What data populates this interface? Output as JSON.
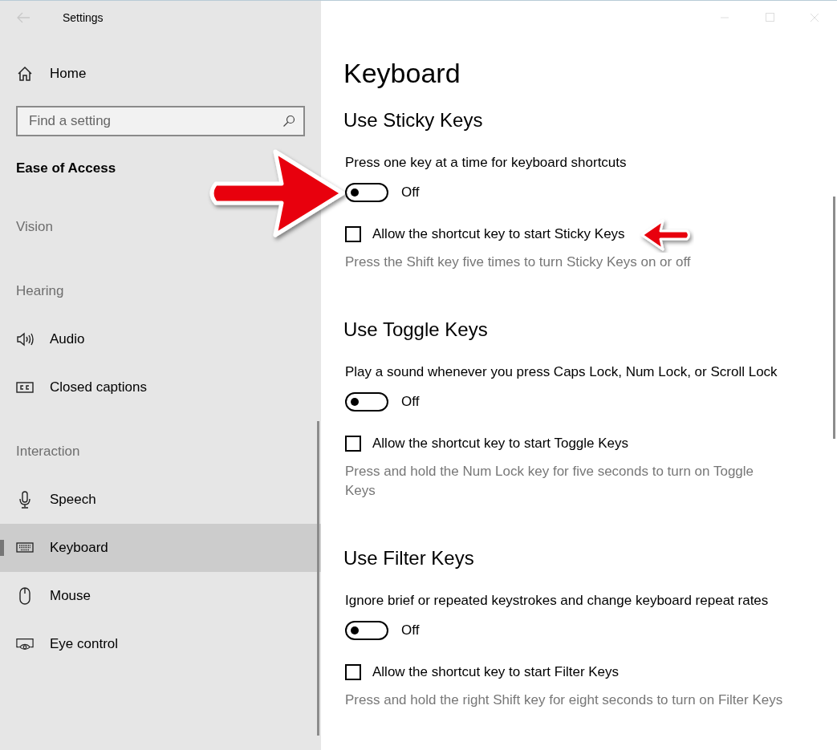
{
  "window": {
    "title": "Settings"
  },
  "sidebar": {
    "home": {
      "label": "Home",
      "selected": false
    },
    "search": {
      "placeholder": "Find a setting"
    },
    "category": "Ease of Access",
    "items": [
      {
        "kind": "heading",
        "label": "Vision"
      },
      {
        "kind": "heading",
        "label": "Hearing"
      },
      {
        "kind": "item",
        "label": "Audio",
        "selected": false
      },
      {
        "kind": "item",
        "label": "Closed captions",
        "selected": false
      },
      {
        "kind": "heading",
        "label": "Interaction"
      },
      {
        "kind": "item",
        "label": "Speech",
        "selected": false
      },
      {
        "kind": "item",
        "label": "Keyboard",
        "selected": true
      },
      {
        "kind": "item",
        "label": "Mouse",
        "selected": false
      },
      {
        "kind": "item",
        "label": "Eye control",
        "selected": false
      }
    ]
  },
  "page": {
    "title": "Keyboard",
    "sections": [
      {
        "heading": "Use Sticky Keys",
        "description": "Press one key at a time for keyboard shortcuts",
        "toggle": {
          "on": false,
          "state_label": "Off"
        },
        "shortcut": {
          "label": "Allow the shortcut key to start Sticky Keys",
          "checked": false
        },
        "hint": "Press the Shift key five times to turn Sticky Keys on or off"
      },
      {
        "heading": "Use Toggle Keys",
        "description": "Play a sound whenever you press Caps Lock, Num Lock, or Scroll Lock",
        "toggle": {
          "on": false,
          "state_label": "Off"
        },
        "shortcut": {
          "label": "Allow the shortcut key to start Toggle Keys",
          "checked": false
        },
        "hint": "Press and hold the Num Lock key for five seconds to turn on Toggle Keys"
      },
      {
        "heading": "Use Filter Keys",
        "description": "Ignore brief or repeated keystrokes and change keyboard repeat rates",
        "toggle": {
          "on": false,
          "state_label": "Off"
        },
        "shortcut": {
          "label": "Allow the shortcut key to start Filter Keys",
          "checked": false
        },
        "hint": "Press and hold the right Shift key for eight seconds to turn on Filter Keys"
      }
    ]
  }
}
